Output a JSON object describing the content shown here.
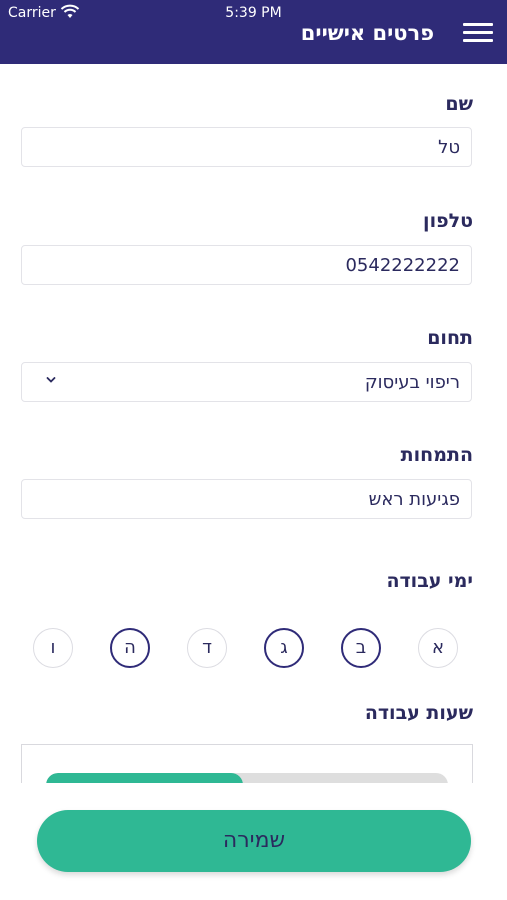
{
  "status_bar": {
    "carrier": "Carrier",
    "time": "5:39 PM"
  },
  "header": {
    "title": "פרטים אישיים",
    "menu_icon": "hamburger-menu-icon"
  },
  "form": {
    "name": {
      "label": "שם",
      "value": "טל"
    },
    "phone": {
      "label": "טלפון",
      "value": "0542222222"
    },
    "field": {
      "label": "תחום",
      "value": "ריפוי בעיסוק"
    },
    "specialty": {
      "label": "התמחות",
      "value": "פגיעות ראש"
    },
    "work_days": {
      "label": "ימי עבודה",
      "days": [
        {
          "label": "א",
          "selected": false
        },
        {
          "label": "ב",
          "selected": true
        },
        {
          "label": "ג",
          "selected": true
        },
        {
          "label": "ד",
          "selected": false
        },
        {
          "label": "ה",
          "selected": true
        },
        {
          "label": "ו",
          "selected": false
        }
      ]
    },
    "work_hours": {
      "label": "שעות עבודה",
      "fill_fraction": 0.49
    }
  },
  "save_button": {
    "label": "שמירה"
  },
  "colors": {
    "header_bg": "#2f2b78",
    "accent": "#2fb894",
    "text": "#2b2a5e"
  }
}
